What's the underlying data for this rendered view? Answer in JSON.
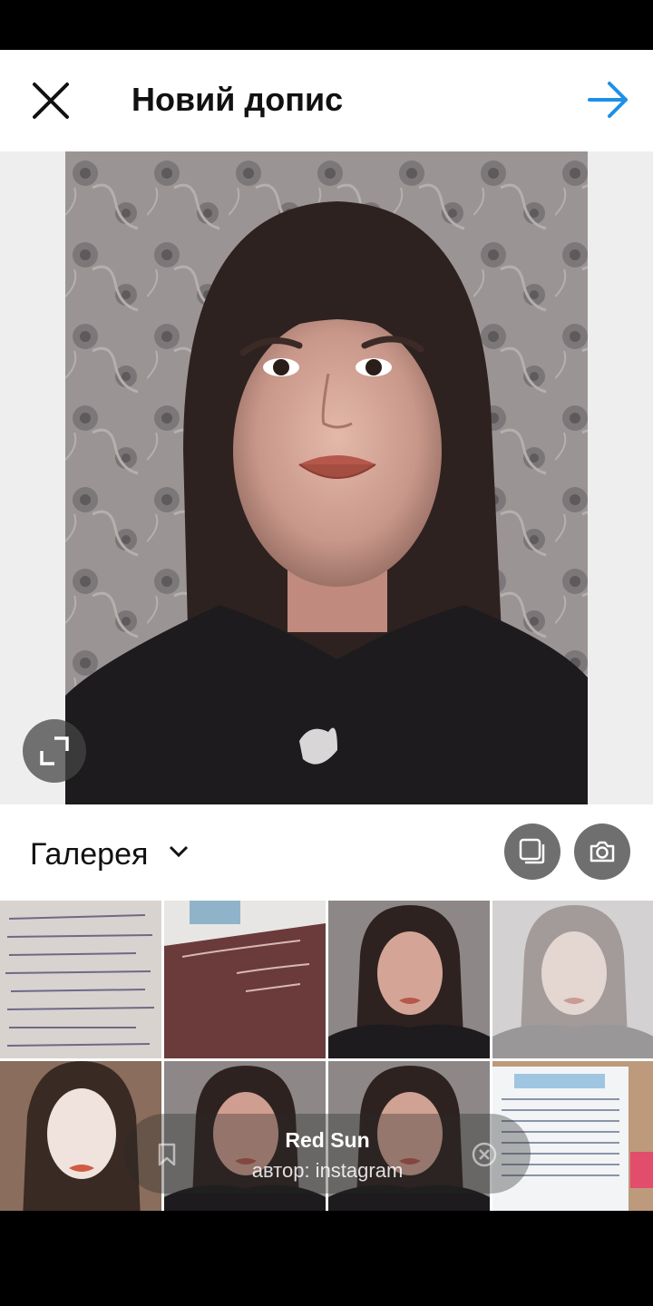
{
  "header": {
    "title": "Новий допис"
  },
  "gallery": {
    "label": "Галерея"
  },
  "music": {
    "song": "Red Sun",
    "author": "автор: instagram"
  },
  "colors": {
    "accent": "#1e90e6",
    "header_bg": "#ffffff",
    "button_gray": "#6f6f6f"
  },
  "icons": {
    "close": "close-icon",
    "next": "arrow-right-icon",
    "expand": "expand-icon",
    "dropdown": "chevron-down-icon",
    "multi_select": "multiple-select-icon",
    "camera": "camera-icon",
    "bookmark": "bookmark-icon",
    "dismiss": "close-circle-icon"
  }
}
